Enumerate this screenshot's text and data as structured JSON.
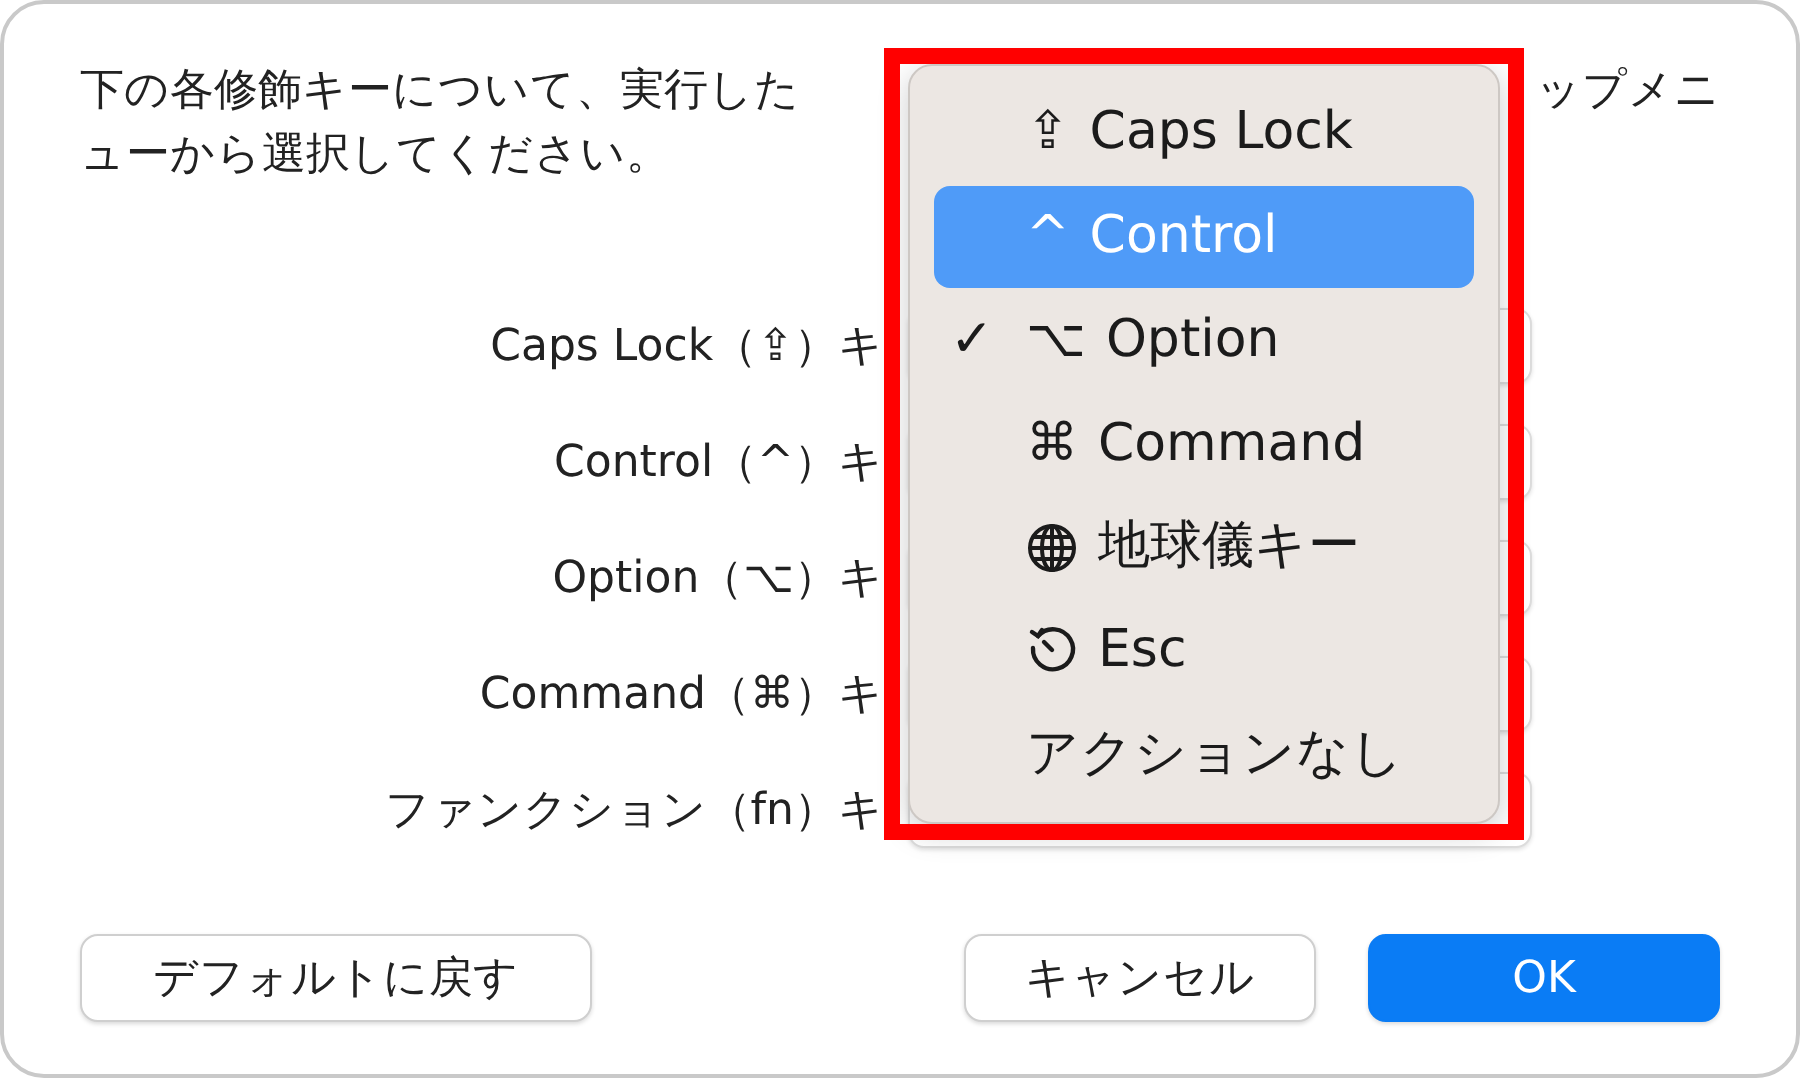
{
  "instructions": {
    "line_1_left": "下の各修飾キーについて、実行した",
    "line_1_right": "ップメニ",
    "line_2": "ューから選択してください。"
  },
  "key_rows": [
    {
      "label": "Caps Lock（⇪）キ"
    },
    {
      "label": "Control（^）キ"
    },
    {
      "label": "Option（⌥）キ"
    },
    {
      "label": "Command（⌘）キ"
    },
    {
      "label": "ファンクション（fn）キ"
    }
  ],
  "popup_menu": {
    "items": [
      {
        "kind": "symbol",
        "symbol": "⇪",
        "label": "Caps Lock",
        "selected": false,
        "checked": false
      },
      {
        "kind": "symbol",
        "symbol": "^",
        "label": "Control",
        "selected": true,
        "checked": false
      },
      {
        "kind": "symbol",
        "symbol": "⌥",
        "label": "Option",
        "selected": false,
        "checked": true
      },
      {
        "kind": "symbol",
        "symbol": "⌘",
        "label": "Command",
        "selected": false,
        "checked": false
      },
      {
        "kind": "globe",
        "label": "地球儀キー",
        "selected": false,
        "checked": false
      },
      {
        "kind": "escape",
        "label": "Esc",
        "selected": false,
        "checked": false
      },
      {
        "kind": "plain",
        "label": "アクションなし",
        "selected": false,
        "checked": false
      }
    ]
  },
  "buttons": [
    {
      "kind": "secondary",
      "label": "デフォルトに戻す"
    },
    {
      "kind": "secondary",
      "label": "キャンセル"
    },
    {
      "kind": "primary",
      "label": "OK"
    }
  ],
  "checkmark": "✓"
}
